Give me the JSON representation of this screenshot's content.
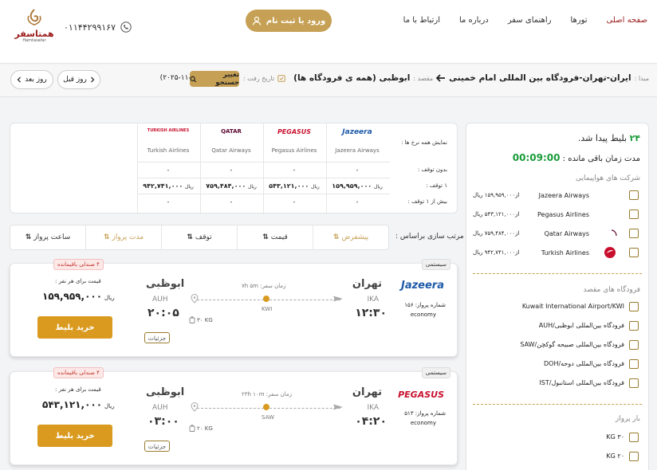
{
  "header": {
    "nav": [
      "صفحه اصلی",
      "تورها",
      "راهنمای سفر",
      "درباره ما",
      "ارتباط با ما"
    ],
    "login_label": "ورود یا ثبت نام",
    "phone": "۰۱۱۴۴۲۹۹۱۶۷",
    "logo_text": "همتاسفر",
    "logo_sub": "Hamtasafar"
  },
  "search": {
    "origin_label": "مبدا :",
    "origin": "ایران-تهران-فرودگاه بین المللی امام خمینی",
    "dest_label": "مقصد :",
    "dest": "ابوظبی (همه ی فرودگاه ها)",
    "date_label": "تاریخ رفت :",
    "date": "۱۴۰۴-۰۸-۱۰ (۲۰۲۵-۱۱-۰۱)",
    "change_label": "تغییر جستجو",
    "prev_day": "روز قبل",
    "next_day": "روز بعد"
  },
  "sidebar": {
    "count_num": "۲۴",
    "count_text": "بلیط پیدا شد.",
    "timer_label": "مدت زمان باقی مانده :",
    "timer": "00:09:00",
    "airlines_title": "شرکت های هواپیمایی",
    "airlines": [
      {
        "name": "Jazeera Airways",
        "price": "از۱۵۹,۹۵۹,۰۰۰ ریال"
      },
      {
        "name": "Pegasus Airlines",
        "price": "از۵۴۳,۱۲۱,۰۰۰ ریال"
      },
      {
        "name": "Qatar Airways",
        "price": "از۷۵۹,۴۸۴,۰۰۰ ریال"
      },
      {
        "name": "Turkish Airlines",
        "price": "از۹۴۲,۷۴۱,۰۰۰ ریال"
      }
    ],
    "airports_title": "فرودگاه های مقصد",
    "airports": [
      "Kuwait International Airport/KWI",
      "فرودگاه بین‌المللی ابوظبی/AUH",
      "فرودگاه بین‌المللی صبیحه گوکچن/SAW",
      "فرودگاه بین‌المللی دوحه/DOH",
      "فرودگاه بین‌المللی استانبول/IST"
    ],
    "baggage_title": "بار پرواز",
    "baggage": [
      "۳۰ KG",
      "۲۰ KG"
    ]
  },
  "matrix": {
    "labels": [
      "نمایش همه نرخ ها :",
      "بدون توقف :",
      "۱ توقف :",
      "بیش از ۱ توقف :"
    ],
    "airlines": [
      "Jazeera Airways",
      "Pegasus Airlines",
      "Qatar Airways",
      "Turkish Airlines"
    ],
    "logos": [
      "Jazeera",
      "PEGASUS",
      "QATAR",
      "TURKISH AIRLINES"
    ],
    "nonstop": [
      "-",
      "-",
      "-",
      "-"
    ],
    "one_stop": [
      "۱۵۹,۹۵۹,۰۰۰",
      "۵۴۳,۱۲۱,۰۰۰",
      "۷۵۹,۴۸۴,۰۰۰",
      "۹۴۲,۷۴۱,۰۰۰"
    ],
    "more": [
      "-",
      "-",
      "-",
      "-"
    ],
    "rial": "ریال"
  },
  "sort": {
    "label": "مرتب سازی براساس :",
    "options": [
      "پیشفرض",
      "قیمت",
      "توقف",
      "مدت پرواز",
      "ساعت پرواز"
    ]
  },
  "flights": [
    {
      "system": "سیستمی",
      "seats": "۴ صندلی باقیمانده",
      "airline_logo": "Jazeera",
      "flight_no": "شماره پرواز: ۱۵۶",
      "class": "economy",
      "from_city": "تهران",
      "from_code": "IKA",
      "dep_time": "۱۲:۳۰",
      "to_city": "ابوظبی",
      "to_code": "AUH",
      "arr_time": "۲۰:۰۵",
      "duration": "زمان سفر: ۷h ۵m",
      "via": "KWI",
      "baggage": "۳۰ KG",
      "price_label": "قیمت برای هر نفر :",
      "price": "۱۵۹,۹۵۹,۰۰۰",
      "currency": "ریال",
      "buy_label": "خرید بلیط",
      "detail_label": "جزئیات"
    },
    {
      "system": "سیستمی",
      "seats": "۴ صندلی باقیمانده",
      "airline_logo": "PEGASUS",
      "flight_no": "شماره پرواز: ۵۱۳",
      "class": "economy",
      "from_city": "تهران",
      "from_code": "IKA",
      "dep_time": "۰۴:۲۰",
      "to_city": "ابوظبی",
      "to_code": "AUH",
      "arr_time": "۰۳:۰۰",
      "duration": "زمان سفر: ۲۳h ۱۰m",
      "via": "SAW",
      "baggage": "۲۰ KG",
      "price_label": "قیمت برای هر نفر :",
      "price": "۵۴۳,۱۲۱,۰۰۰",
      "currency": "ریال",
      "buy_label": "خرید بلیط",
      "detail_label": "جزئیات"
    }
  ],
  "colors": {
    "accent": "#c6a054",
    "buy": "#d99a1f",
    "brand": "#9b1b1b",
    "timer": "#1a9b3a"
  }
}
